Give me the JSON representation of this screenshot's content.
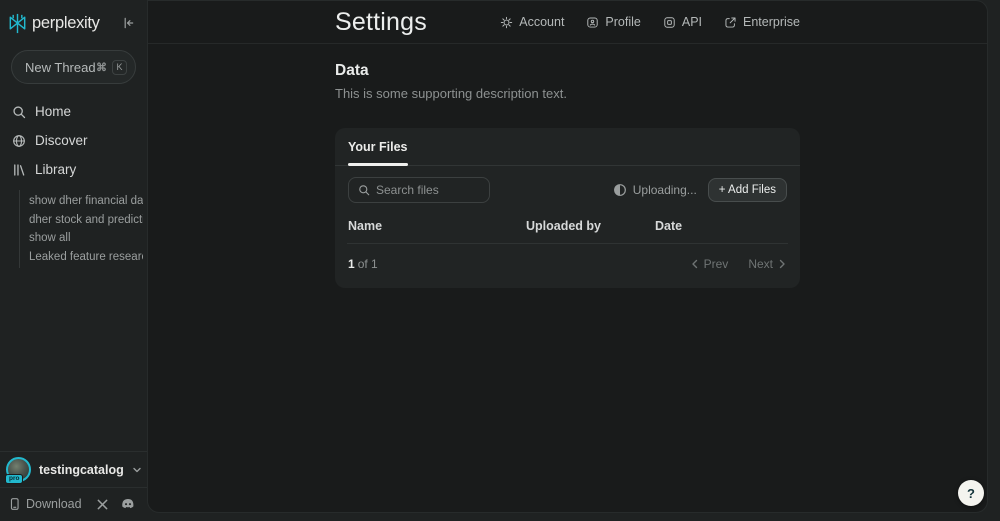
{
  "colors": {
    "accent_teal": "#22b9ce",
    "frame_bg": "#1f2222",
    "panel_bg": "#191b1b",
    "card_bg": "#212424"
  },
  "sidebar": {
    "brand": "perplexity",
    "new_thread": {
      "label": "New Thread",
      "shortcut_modifier": "⌘",
      "shortcut_key": "K"
    },
    "nav": [
      {
        "label": "Home",
        "icon": "search-icon"
      },
      {
        "label": "Discover",
        "icon": "globe-icon"
      },
      {
        "label": "Library",
        "icon": "library-icon"
      }
    ],
    "threads": [
      "show dher financial data",
      "dher stock and predictio…",
      "show all",
      "Leaked feature research"
    ],
    "account": {
      "username": "testingcatalog",
      "plan_badge": "pro"
    },
    "footer": {
      "download": "Download"
    }
  },
  "header": {
    "title": "Settings",
    "nav": [
      {
        "label": "Account",
        "icon": "gear-icon"
      },
      {
        "label": "Profile",
        "icon": "profile-card-icon"
      },
      {
        "label": "API",
        "icon": "api-icon"
      },
      {
        "label": "Enterprise",
        "icon": "external-link-icon"
      }
    ]
  },
  "main": {
    "section": {
      "title": "Data",
      "description": "This is some supporting description text."
    },
    "card": {
      "tab": "Your Files",
      "search_placeholder": "Search files",
      "uploading": "Uploading...",
      "add_files": "+ Add Files",
      "columns": [
        "Name",
        "Uploaded by",
        "Date"
      ],
      "rows": [],
      "pagination": {
        "current": "1",
        "of": "of 1",
        "prev": "Prev",
        "next": "Next"
      }
    }
  },
  "help": {
    "label": "?"
  }
}
